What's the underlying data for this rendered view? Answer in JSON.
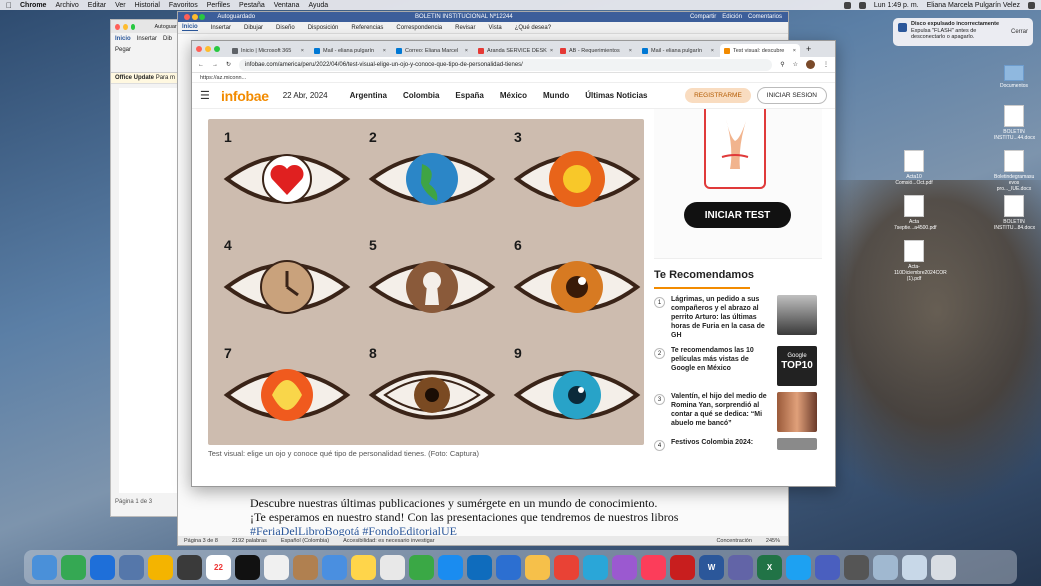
{
  "menubar": {
    "app": "Chrome",
    "items": [
      "Archivo",
      "Editar",
      "Ver",
      "Historial",
      "Favoritos",
      "Perfiles",
      "Pestaña",
      "Ventana",
      "Ayuda"
    ],
    "clock": "Lun 1:49 p. m.",
    "user": "Eliana Marcela Pulgarín Velez"
  },
  "word_back": {
    "title": "Autoguardado",
    "tabs": [
      "Inicio",
      "Insertar",
      "Dib"
    ],
    "paste": "Pegar",
    "update_bar": "Office Update",
    "update_bar_more": "Para m",
    "status": "Página 1 de 3"
  },
  "doc": {
    "title_left": "Autoguardado",
    "title": "BOLETIN INSTITUCIONAL Nº12244",
    "share": "Compartir",
    "edit": "Edición",
    "comments": "Comentarios",
    "menu": [
      "Inicio",
      "Insertar",
      "Dibujar",
      "Diseño",
      "Disposición",
      "Referencias",
      "Correspondencia",
      "Revisar",
      "Vista",
      "¿Qué desea?"
    ],
    "body_line1": "Descubre nuestras últimas publicaciones y sumérgete en un mundo de conocimiento.",
    "body_line2": "¡Te esperamos en nuestro stand! Con las presentaciones que tendremos de nuestros libros",
    "hashtag1": "#FeriaDelLibroBogotá",
    "hashtag2": "#FondoEditorialUE",
    "status": [
      "Página 3 de 8",
      "2192 palabras",
      "Español (Colombia)",
      "Accesibilidad: es necesario investigar",
      "Concentración",
      "245%"
    ]
  },
  "chrome": {
    "tabs": [
      {
        "label": "Inicio | Microsoft 365",
        "active": false
      },
      {
        "label": "Mail - eliana pulgarín",
        "active": false
      },
      {
        "label": "Correo: Eliana Marcel",
        "active": false
      },
      {
        "label": "Aranda SERVICE DESK",
        "active": false
      },
      {
        "label": "AB - Requerimientos",
        "active": false
      },
      {
        "label": "Mail - eliana pulgarín",
        "active": false
      },
      {
        "label": "Test visual: descubre",
        "active": true
      }
    ],
    "url": "infobae.com/america/peru/2022/04/06/test-visual-elige-un-ojo-y-conoce-que-tipo-de-personalidad-tienes/",
    "bookmark": "https://az.miconn..."
  },
  "site": {
    "logo": "infobae",
    "date": "22 Abr, 2024",
    "nav": [
      "Argentina",
      "Colombia",
      "España",
      "México",
      "Mundo",
      "Últimas Noticias"
    ],
    "register": "REGISTRARME",
    "login": "INICIAR SESION",
    "eye_numbers": [
      "1",
      "2",
      "3",
      "4",
      "5",
      "6",
      "7",
      "8",
      "9"
    ],
    "caption": "Test visual: elige un ojo y conoce qué tipo de personalidad tienes. (Foto: Captura)",
    "test_button": "INICIAR TEST",
    "recommended_title": "Te Recomendamos",
    "recommended": [
      {
        "num": "1",
        "text": "Lágrimas, un pedido a sus compañeros y el abrazo al perrito Arturo: las últimas horas de Furia en la casa de GH"
      },
      {
        "num": "2",
        "text": "Te recomendamos las 10 películas más vistas de Google en México"
      },
      {
        "num": "3",
        "text": "Valentín, el hijo del medio de Romina Yan, sorprendió al contar a qué se dedica: “Mi abuelo me bancó”"
      },
      {
        "num": "4",
        "text": "Festivos Colombia 2024:"
      }
    ],
    "google_thumb": "Google",
    "google_thumb2": "TOP10"
  },
  "notification": {
    "title": "Disco expulsado incorrectamente",
    "body": "Expulsa \"FLASH\" antes de desconectarlo o apagarlo.",
    "close": "Cerrar"
  },
  "desktop_icons": [
    "BOLETIN INSTITU...44.docx",
    "Boletindegramasu evos pro..._IUE.docx",
    "BOLETIN INSTITU...84.docx",
    "Acta-110Diciembre2024COR (1).pdf",
    "Acta 7septie...a4500.pdf",
    "Acta10 Comsió...Oct.pdf",
    "Documentos"
  ],
  "colors": {
    "brand": "#f28b00",
    "word_blue": "#2b579a"
  }
}
